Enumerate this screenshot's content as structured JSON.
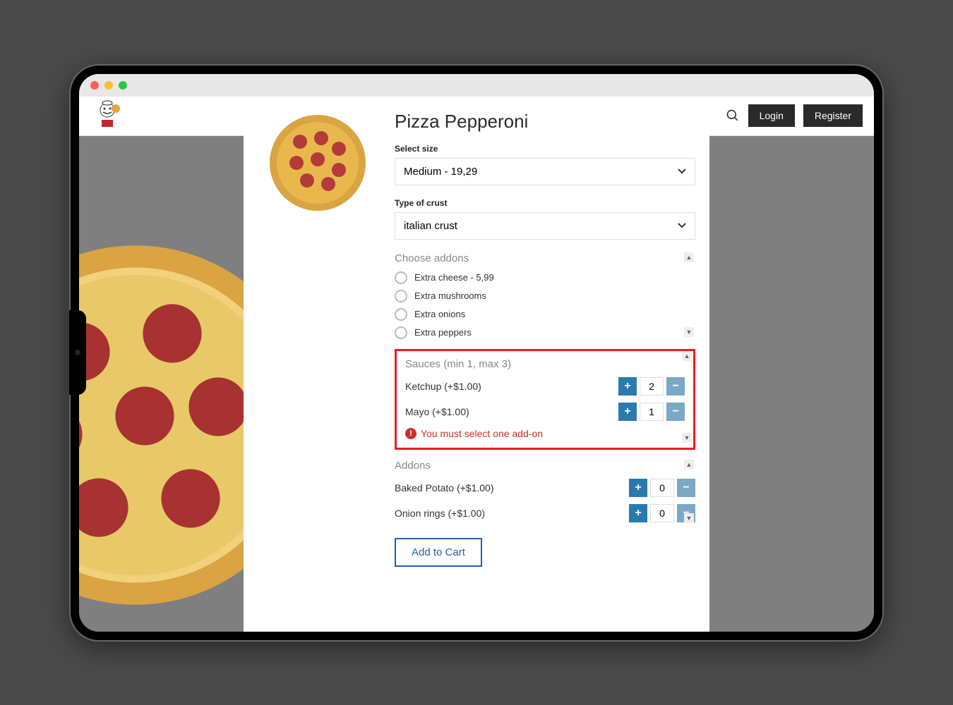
{
  "header": {
    "login": "Login",
    "register": "Register"
  },
  "product": {
    "title": "Pizza Pepperoni",
    "size_label": "Select size",
    "size_value": "Medium - 19,29",
    "crust_label": "Type of crust",
    "crust_value": "italian crust"
  },
  "addons_section": {
    "title": "Choose addons",
    "items": [
      "Extra cheese - 5,99",
      "Extra mushrooms",
      "Extra onions",
      "Extra peppers"
    ]
  },
  "sauces": {
    "title": "Sauces (min 1, max 3)",
    "items": [
      {
        "label": "Ketchup (+$1.00)",
        "qty": "2"
      },
      {
        "label": "Mayo (+$1.00)",
        "qty": "1"
      }
    ],
    "error": "You must select one add-on"
  },
  "extras": {
    "title": "Addons",
    "items": [
      {
        "label": "Baked Potato (+$1.00)",
        "qty": "0"
      },
      {
        "label": "Onion rings (+$1.00)",
        "qty": "0"
      }
    ]
  },
  "cart_button": "Add to Cart"
}
